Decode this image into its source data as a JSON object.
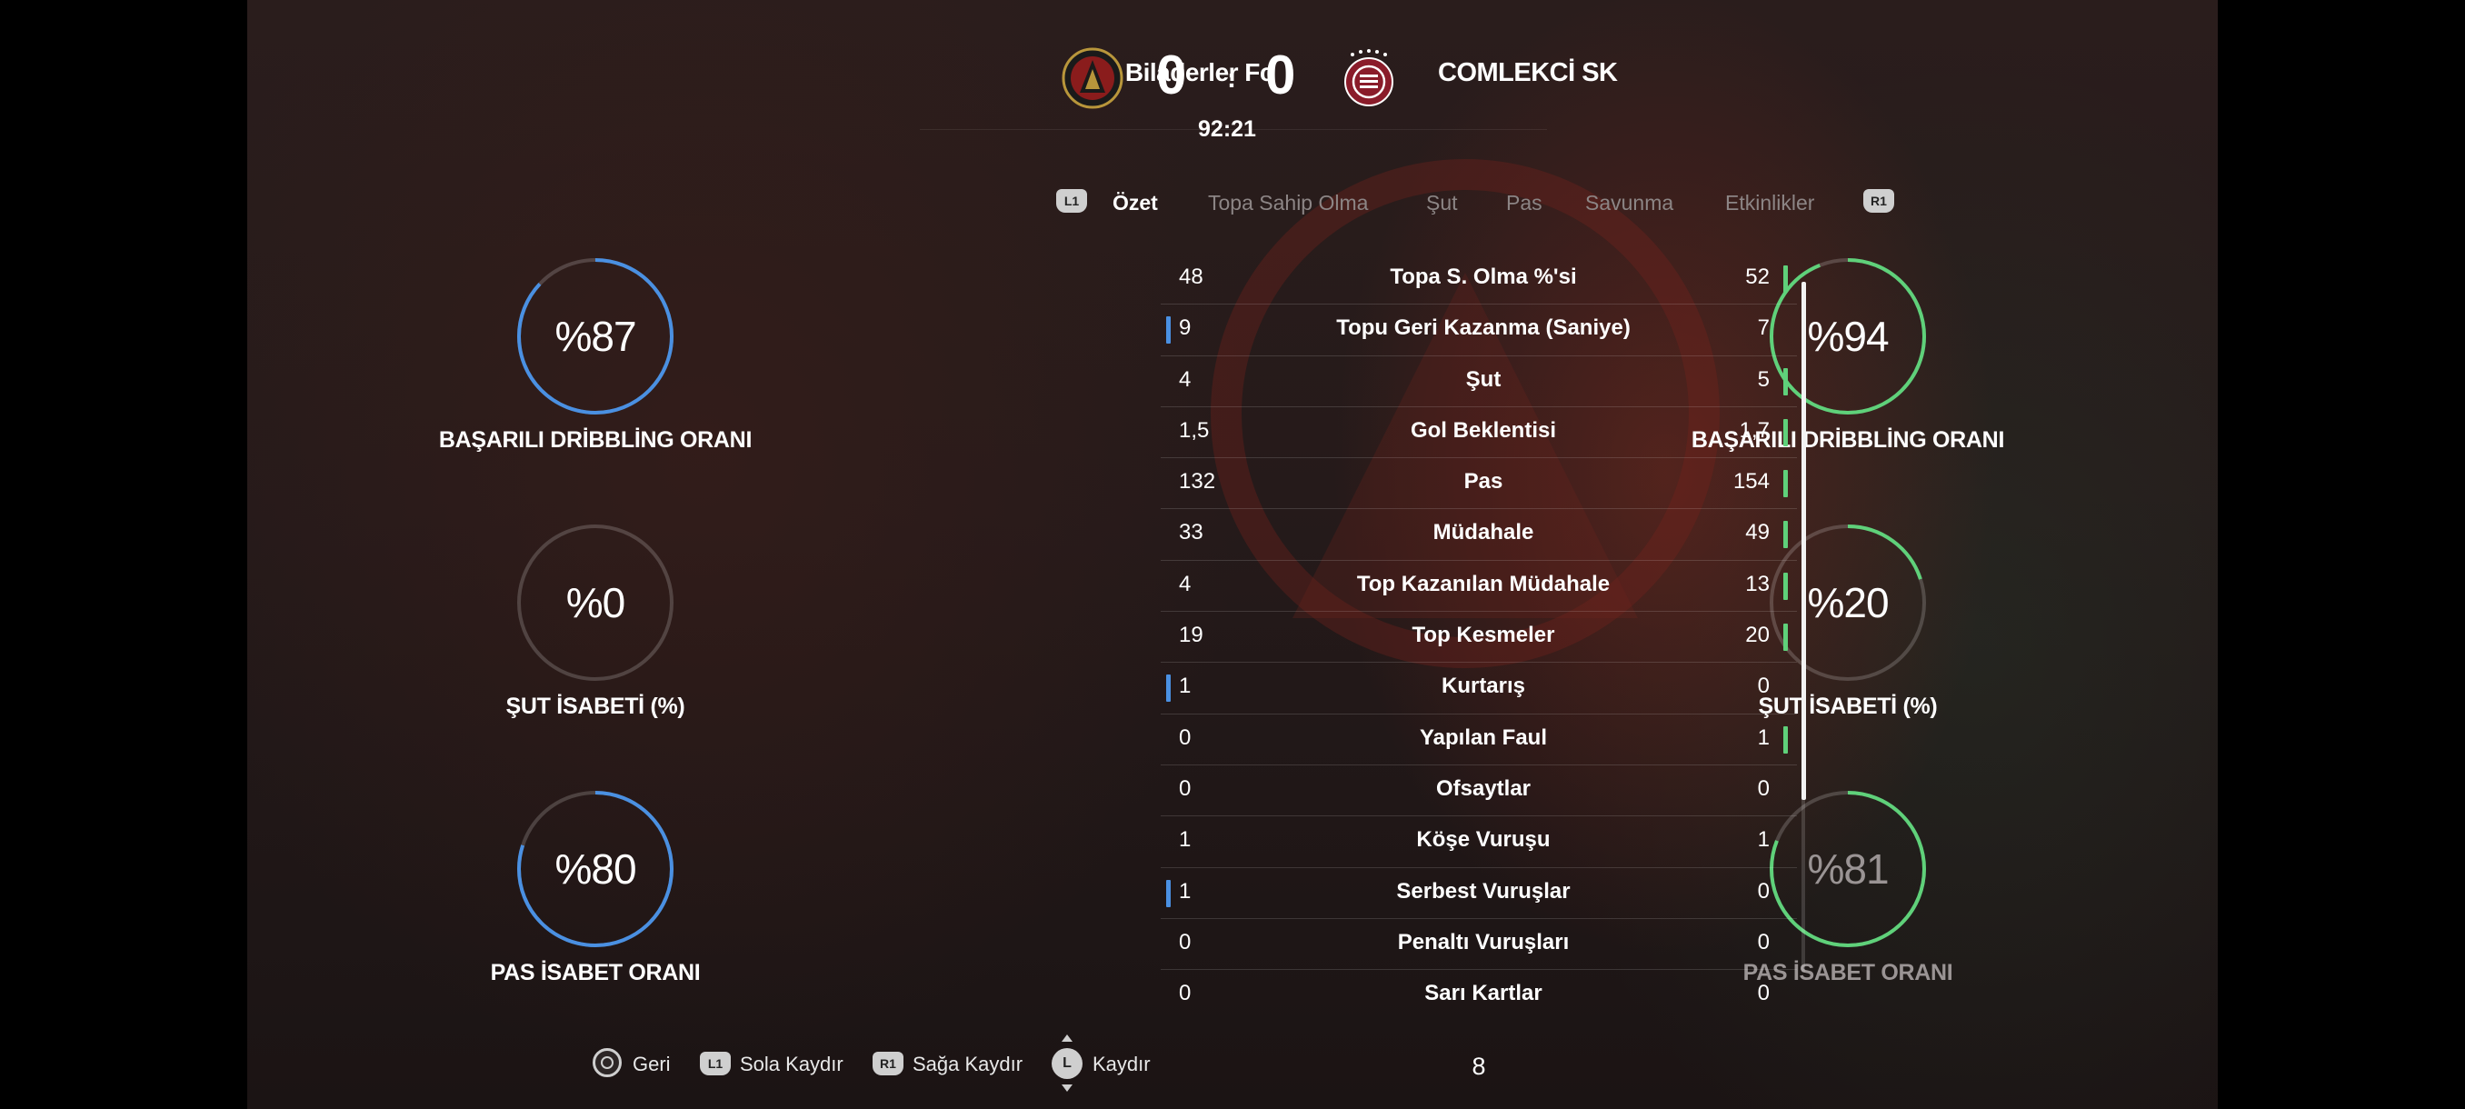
{
  "header": {
    "home_team": "Biladerler Fc",
    "away_team": "COMLEKCİ SK",
    "home_score": "0",
    "away_score": "0",
    "separator": ":",
    "match_time": "92:21"
  },
  "tabs": {
    "l1": "L1",
    "r1": "R1",
    "items": [
      "Özet",
      "Topa Sahip Olma",
      "Şut",
      "Pas",
      "Savunma",
      "Etkinlikler"
    ],
    "active": "Özet"
  },
  "home_gauges": [
    {
      "value": "%87",
      "percent": 87,
      "label": "BAŞARILI DRİBBLİNG ORANI",
      "color": "#4a90e2"
    },
    {
      "value": "%0",
      "percent": 0,
      "label": "ŞUT İSABETİ (%)",
      "color": "#4a90e2"
    },
    {
      "value": "%80",
      "percent": 80,
      "label": "PAS İSABET ORANI",
      "color": "#4a90e2"
    }
  ],
  "away_gauges": [
    {
      "value": "%94",
      "percent": 94,
      "label": "BAŞARILI DRİBBLİNG ORANI",
      "color": "#5fd17a"
    },
    {
      "value": "%20",
      "percent": 20,
      "label": "ŞUT İSABETİ (%)",
      "color": "#5fd17a"
    },
    {
      "value": "%81",
      "percent": 81,
      "label": "PAS İSABET ORANI",
      "color": "#5fd17a"
    }
  ],
  "stats": [
    {
      "name": "Topa S. Olma %'si",
      "home": "48",
      "away": "52",
      "leader": "away"
    },
    {
      "name": "Topu Geri Kazanma (Saniye)",
      "home": "9",
      "away": "7",
      "leader": "home"
    },
    {
      "name": "Şut",
      "home": "4",
      "away": "5",
      "leader": "away"
    },
    {
      "name": "Gol Beklentisi",
      "home": "1,5",
      "away": "1,7",
      "leader": "away"
    },
    {
      "name": "Pas",
      "home": "132",
      "away": "154",
      "leader": "away"
    },
    {
      "name": "Müdahale",
      "home": "33",
      "away": "49",
      "leader": "away"
    },
    {
      "name": "Top Kazanılan Müdahale",
      "home": "4",
      "away": "13",
      "leader": "away"
    },
    {
      "name": "Top Kesmeler",
      "home": "19",
      "away": "20",
      "leader": "away"
    },
    {
      "name": "Kurtarış",
      "home": "1",
      "away": "0",
      "leader": "home"
    },
    {
      "name": "Yapılan Faul",
      "home": "0",
      "away": "1",
      "leader": "away"
    },
    {
      "name": "Ofsaytlar",
      "home": "0",
      "away": "0",
      "leader": "none"
    },
    {
      "name": "Köşe Vuruşu",
      "home": "1",
      "away": "1",
      "leader": "none"
    },
    {
      "name": "Serbest Vuruşlar",
      "home": "1",
      "away": "0",
      "leader": "home"
    },
    {
      "name": "Penaltı Vuruşları",
      "home": "0",
      "away": "0",
      "leader": "none"
    },
    {
      "name": "Sarı Kartlar",
      "home": "0",
      "away": "0",
      "leader": "none"
    }
  ],
  "footer": {
    "back": "Geri",
    "l1_badge": "L1",
    "scroll_left": "Sola Kaydır",
    "r1_badge": "R1",
    "scroll_right": "Sağa Kaydır",
    "l_badge": "L",
    "scroll": "Kaydır",
    "page": "8"
  },
  "colors": {
    "home_accent": "#4a90e2",
    "away_accent": "#5fd17a"
  }
}
